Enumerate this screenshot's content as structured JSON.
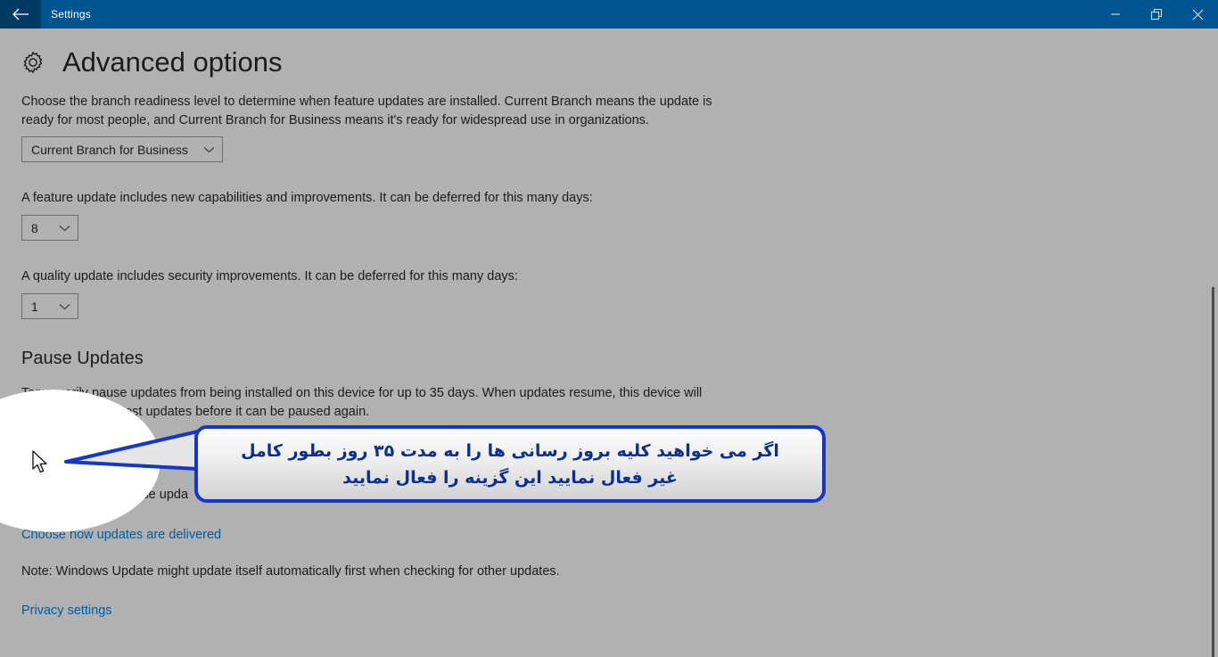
{
  "window": {
    "title": "Settings",
    "back_icon": "back-arrow-icon",
    "minimize_label": "Minimize",
    "restore_label": "Restore",
    "close_label": "Close",
    "titlebar_color": "#00548f",
    "back_button_color": "#013b63"
  },
  "page": {
    "icon": "gear-icon",
    "title": "Advanced options",
    "background_color": "#b1b1b1",
    "text_color": "#1b1b1b",
    "link_color": "#005a9e"
  },
  "branch": {
    "description": "Choose the branch readiness level to determine when feature updates are installed. Current Branch means the update is ready for most people, and Current Branch for Business means it's ready for widespread use in organizations.",
    "dropdown_value": "Current Branch for Business"
  },
  "feature_update": {
    "description": "A feature update includes new capabilities and improvements. It can be deferred for this many days:",
    "dropdown_value": "8"
  },
  "quality_update": {
    "description": "A quality update includes security improvements. It can be deferred for this many days:",
    "dropdown_value": "1"
  },
  "pause_updates": {
    "heading": "Pause Updates",
    "description": "Temporarily pause updates from being installed on this device for up to 35 days. When updates resume, this device will need to get the latest updates before it can be paused again.",
    "toggle_state": "Off",
    "note": "Pausing now will pause upda"
  },
  "links": {
    "delivery": "Choose how updates are delivered",
    "privacy": "Privacy settings"
  },
  "note": {
    "text": "Note: Windows Update might update itself automatically first when checking for other updates."
  },
  "callout": {
    "line1": "اگر می خواهید کلیه بروز رسانی ها را به مدت ۳۵ روز بطور کامل",
    "line2": "غیر فعال نمایید این گزینه را فعال نمایید",
    "border_color": "#1437c8",
    "text_color": "#0b2f8f"
  }
}
